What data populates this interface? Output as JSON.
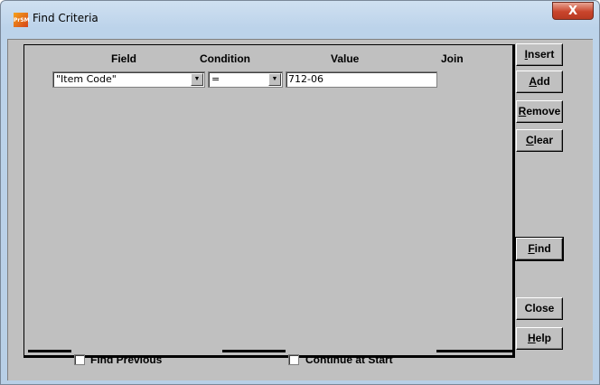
{
  "window": {
    "title": "Find Criteria",
    "icon": "app-icon",
    "icon_text": "PrSM",
    "close_glyph": "X"
  },
  "columns": {
    "field": "Field",
    "condition": "Condition",
    "value": "Value",
    "join": "Join"
  },
  "criteria_row": {
    "field": "\"Item Code\"",
    "condition": "=",
    "value": "712-06"
  },
  "buttons": {
    "insert_first": "I",
    "insert_rest": "nsert",
    "add_first": "A",
    "add_rest": "dd",
    "remove_first": "R",
    "remove_rest": "emove",
    "clear_first": "C",
    "clear_rest": "lear",
    "find_first": "F",
    "find_rest": "ind",
    "close": "Close",
    "help_first": "H",
    "help_rest": "elp"
  },
  "options": {
    "find_previous": "Find Previous",
    "continue_at_start": "Continue at Start"
  },
  "colors": {
    "titlebar": "#bcd3ea",
    "client": "#c0c0c0",
    "close_button": "#c9452c"
  }
}
